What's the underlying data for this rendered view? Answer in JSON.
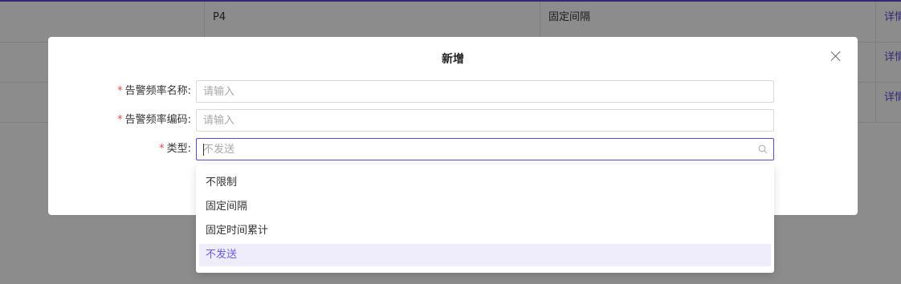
{
  "background_table": {
    "rows": [
      {
        "cells": [
          "",
          "P4",
          "固定间隔",
          "详情"
        ]
      },
      {
        "cells": [
          "",
          "",
          "",
          "详情"
        ]
      },
      {
        "cells": [
          "",
          "",
          "",
          "详情"
        ]
      }
    ]
  },
  "modal": {
    "title": "新增",
    "fields": [
      {
        "label": "告警频率名称:",
        "required": true,
        "placeholder": "请输入",
        "value": ""
      },
      {
        "label": "告警频率编码:",
        "required": true,
        "placeholder": "请输入",
        "value": ""
      },
      {
        "label": "类型:",
        "required": true,
        "placeholder": "不发送",
        "value": ""
      }
    ],
    "required_mark": "*"
  },
  "dropdown": {
    "options": [
      "不限制",
      "固定间隔",
      "固定时间累计",
      "不发送"
    ],
    "selected": "不发送"
  },
  "colors": {
    "accent": "#5b4ad6",
    "selected_bg": "#efedfc",
    "required": "#e5484d"
  },
  "icons": {
    "close": "close-icon",
    "search": "search-icon"
  }
}
